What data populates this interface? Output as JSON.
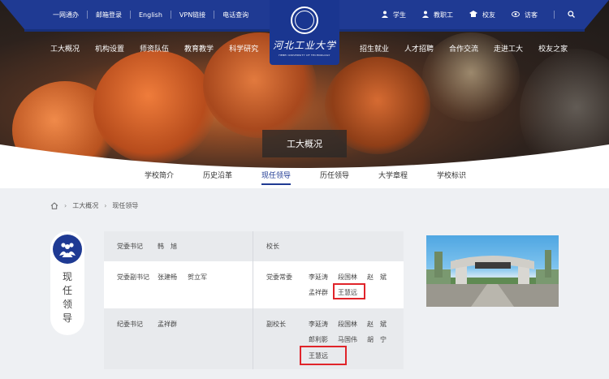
{
  "topbar": {
    "left_links": [
      "一网通办",
      "邮箱登录",
      "English",
      "VPN链接",
      "电话查询"
    ],
    "right_links": [
      {
        "label": "学生",
        "icon": "user-icon"
      },
      {
        "label": "教职工",
        "icon": "staff-icon"
      },
      {
        "label": "校友",
        "icon": "alumni-icon"
      },
      {
        "label": "访客",
        "icon": "eye-icon"
      }
    ],
    "search_icon": "search-icon"
  },
  "logo": {
    "name": "河北工业大学",
    "en": "HEBEI UNIVERSITY OF TECHNOLOGY"
  },
  "mainnav": {
    "left": [
      "工大概况",
      "机构设置",
      "师资队伍",
      "教育教学",
      "科学研究"
    ],
    "right": [
      "招生就业",
      "人才招聘",
      "合作交流",
      "走进工大",
      "校友之家"
    ]
  },
  "page_label": "工大概况",
  "subnav": {
    "items": [
      "学校简介",
      "历史沿革",
      "现任领导",
      "历任领导",
      "大学章程",
      "学校标识"
    ],
    "active_index": 2
  },
  "breadcrumb": [
    "工大概况",
    "现任领导"
  ],
  "side_title": "现任领导",
  "leaders": {
    "r1_left_title": "党委书记",
    "r1_left_names": [
      "韩　旭"
    ],
    "r1_right_title": "校长",
    "r2_left_title": "党委副书记",
    "r2_left_names": [
      "张建畅",
      "贺立军"
    ],
    "r2_right_title": "党委常委",
    "r2_right_names": [
      "李延涛",
      "段国林",
      "赵　斌",
      "孟祥群",
      "王慧远"
    ],
    "r3_left_title": "纪委书记",
    "r3_left_names": [
      "孟祥群"
    ],
    "r3_right_title": "副校长",
    "r3_right_names": [
      "李延涛",
      "段国林",
      "赵　斌",
      "郎利影",
      "马国伟",
      "胡　宁",
      "王慧远"
    ]
  },
  "colors": {
    "brand_blue": "#1f3a93",
    "highlight_red": "#e0242a"
  }
}
